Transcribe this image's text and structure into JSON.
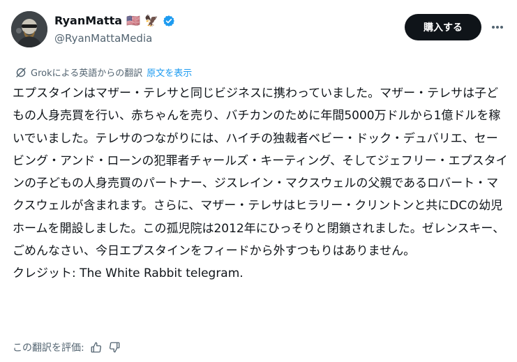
{
  "author": {
    "display_name": "RyanMatta",
    "handle": "@RyanMattaMedia",
    "flag_emoji": "🇺🇸",
    "eagle_emoji": "🦅",
    "verified_color": "#1d9bf0"
  },
  "header": {
    "subscribe_label": "購入する",
    "more_icon": "more-horizontal-icon"
  },
  "translation": {
    "source_text": "Grokによる英語からの翻訳",
    "show_original_label": "原文を表示",
    "icon": "grok-slash-icon"
  },
  "tweet": {
    "text": "エプスタインはマザー・テレサと同じビジネスに携わっていました。マザー・テレサは子どもの人身売買を行い、赤ちゃんを売り、バチカンのために年間5000万ドルから1億ドルを稼いでいました。テレサのつながりには、ハイチの独裁者ベビー・ドック・デュバリエ、セービング・アンド・ローンの犯罪者チャールズ・キーティング、そしてジェフリー・エプスタインの子どもの人身売買のパートナー、ジスレイン・マクスウェルの父親であるロバート・マクスウェルが含まれます。さらに、マザー・テレサはヒラリー・クリントンと共にDCの幼児ホームを開設しました。この孤児院は2012年にひっそりと閉鎖されました。ゼレンスキー、ごめんなさい、今日エプスタインをフィードから外すつもりはありません。\nクレジット: The White Rabbit telegram."
  },
  "rating": {
    "label": "この翻訳を評価:",
    "thumbs_up_icon": "thumbs-up-icon",
    "thumbs_down_icon": "thumbs-down-icon"
  },
  "colors": {
    "text_primary": "#0f1419",
    "text_secondary": "#536471",
    "link": "#1d9bf0",
    "button_bg": "#0f1419"
  }
}
